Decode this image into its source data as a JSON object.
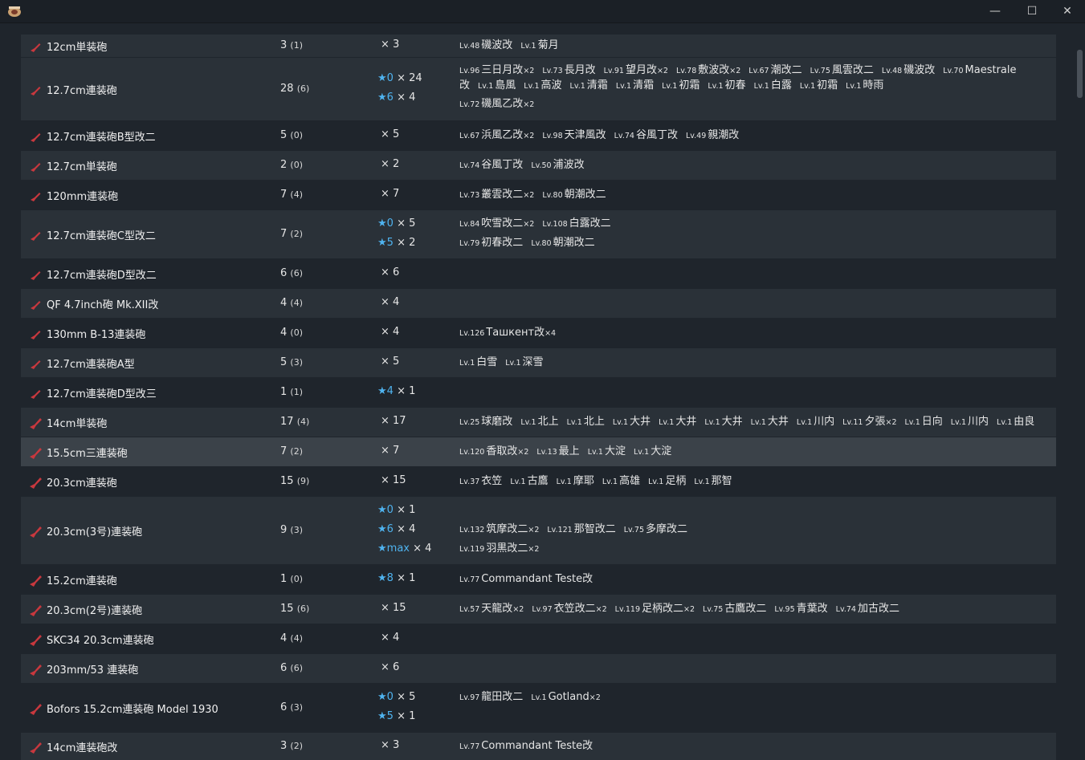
{
  "window": {
    "minimize": "—",
    "maximize": "☐",
    "close": "✕"
  },
  "colors": {
    "row_alt": "#2a3138",
    "row_selected": "#3b4249",
    "star": "#4fb3ef",
    "gun_icon": "#c8383e"
  },
  "rows": [
    {
      "name": "12cm単装砲",
      "count": "3",
      "count_locked": "(1)",
      "improvements": [
        {
          "star": "",
          "times": "× 3"
        }
      ],
      "ships": [
        [
          {
            "lv": "Lv.48",
            "name": "磯波改"
          },
          {
            "lv": "Lv.1",
            "name": "菊月"
          }
        ]
      ]
    },
    {
      "name": "12.7cm連装砲",
      "count": "28",
      "count_locked": "(6)",
      "improvements": [
        {
          "star": "★0",
          "times": "× 24"
        },
        {
          "star": "★6",
          "times": "× 4"
        }
      ],
      "ships": [
        [
          {
            "lv": "Lv.96",
            "name": "三日月改",
            "mult": "×2"
          },
          {
            "lv": "Lv.73",
            "name": "長月改"
          },
          {
            "lv": "Lv.91",
            "name": "望月改",
            "mult": "×2"
          },
          {
            "lv": "Lv.78",
            "name": "敷波改",
            "mult": "×2"
          },
          {
            "lv": "Lv.67",
            "name": "潮改二"
          },
          {
            "lv": "Lv.75",
            "name": "風雲改二"
          },
          {
            "lv": "Lv.48",
            "name": "磯波改"
          },
          {
            "lv": "Lv.70",
            "name": "Maestrale改"
          },
          {
            "lv": "Lv.1",
            "name": "島風"
          },
          {
            "lv": "Lv.1",
            "name": "高波"
          },
          {
            "lv": "Lv.1",
            "name": "清霜"
          },
          {
            "lv": "Lv.1",
            "name": "清霜"
          },
          {
            "lv": "Lv.1",
            "name": "初霜"
          },
          {
            "lv": "Lv.1",
            "name": "初春"
          },
          {
            "lv": "Lv.1",
            "name": "白露"
          },
          {
            "lv": "Lv.1",
            "name": "初霜"
          },
          {
            "lv": "Lv.1",
            "name": "時雨"
          }
        ],
        [
          {
            "lv": "Lv.72",
            "name": "磯風乙改",
            "mult": "×2"
          }
        ]
      ]
    },
    {
      "name": "12.7cm連装砲B型改二",
      "count": "5",
      "count_locked": "(0)",
      "improvements": [
        {
          "star": "",
          "times": "× 5"
        }
      ],
      "ships": [
        [
          {
            "lv": "Lv.67",
            "name": "浜風乙改",
            "mult": "×2"
          },
          {
            "lv": "Lv.98",
            "name": "天津風改"
          },
          {
            "lv": "Lv.74",
            "name": "谷風丁改"
          },
          {
            "lv": "Lv.49",
            "name": "親潮改"
          }
        ]
      ]
    },
    {
      "name": "12.7cm単装砲",
      "count": "2",
      "count_locked": "(0)",
      "improvements": [
        {
          "star": "",
          "times": "× 2"
        }
      ],
      "ships": [
        [
          {
            "lv": "Lv.74",
            "name": "谷風丁改"
          },
          {
            "lv": "Lv.50",
            "name": "浦波改"
          }
        ]
      ]
    },
    {
      "name": "120mm連装砲",
      "count": "7",
      "count_locked": "(4)",
      "improvements": [
        {
          "star": "",
          "times": "× 7"
        }
      ],
      "ships": [
        [
          {
            "lv": "Lv.73",
            "name": "叢雲改二",
            "mult": "×2"
          },
          {
            "lv": "Lv.80",
            "name": "朝潮改二"
          }
        ]
      ]
    },
    {
      "name": "12.7cm連装砲C型改二",
      "count": "7",
      "count_locked": "(2)",
      "improvements": [
        {
          "star": "★0",
          "times": "× 5"
        },
        {
          "star": "★5",
          "times": "× 2"
        }
      ],
      "ships": [
        [
          {
            "lv": "Lv.84",
            "name": "吹雪改二",
            "mult": "×2"
          },
          {
            "lv": "Lv.108",
            "name": "白露改二"
          }
        ],
        [
          {
            "lv": "Lv.79",
            "name": "初春改二"
          },
          {
            "lv": "Lv.80",
            "name": "朝潮改二"
          }
        ]
      ]
    },
    {
      "name": "12.7cm連装砲D型改二",
      "count": "6",
      "count_locked": "(6)",
      "improvements": [
        {
          "star": "",
          "times": "× 6"
        }
      ],
      "ships": []
    },
    {
      "name": "QF 4.7inch砲 Mk.XII改",
      "count": "4",
      "count_locked": "(4)",
      "improvements": [
        {
          "star": "",
          "times": "× 4"
        }
      ],
      "ships": []
    },
    {
      "name": "130mm B-13連装砲",
      "count": "4",
      "count_locked": "(0)",
      "improvements": [
        {
          "star": "",
          "times": "× 4"
        }
      ],
      "ships": [
        [
          {
            "lv": "Lv.126",
            "name": "Ташкент改",
            "mult": "×4"
          }
        ]
      ]
    },
    {
      "name": "12.7cm連装砲A型",
      "count": "5",
      "count_locked": "(3)",
      "improvements": [
        {
          "star": "",
          "times": "× 5"
        }
      ],
      "ships": [
        [
          {
            "lv": "Lv.1",
            "name": "白雪"
          },
          {
            "lv": "Lv.1",
            "name": "深雪"
          }
        ]
      ]
    },
    {
      "name": "12.7cm連装砲D型改三",
      "count": "1",
      "count_locked": "(1)",
      "improvements": [
        {
          "star": "★4",
          "times": "× 1"
        }
      ],
      "ships": []
    },
    {
      "name": "14cm単装砲",
      "count": "17",
      "count_locked": "(4)",
      "improvements": [
        {
          "star": "",
          "times": "× 17"
        }
      ],
      "ships": [
        [
          {
            "lv": "Lv.25",
            "name": "球磨改"
          },
          {
            "lv": "Lv.1",
            "name": "北上"
          },
          {
            "lv": "Lv.1",
            "name": "北上"
          },
          {
            "lv": "Lv.1",
            "name": "大井"
          },
          {
            "lv": "Lv.1",
            "name": "大井"
          },
          {
            "lv": "Lv.1",
            "name": "大井"
          },
          {
            "lv": "Lv.1",
            "name": "大井"
          },
          {
            "lv": "Lv.1",
            "name": "川内"
          },
          {
            "lv": "Lv.11",
            "name": "夕張",
            "mult": "×2"
          },
          {
            "lv": "Lv.1",
            "name": "日向"
          },
          {
            "lv": "Lv.1",
            "name": "川内"
          },
          {
            "lv": "Lv.1",
            "name": "由良"
          }
        ]
      ]
    },
    {
      "name": "15.5cm三連装砲",
      "count": "7",
      "count_locked": "(2)",
      "improvements": [
        {
          "star": "",
          "times": "× 7"
        }
      ],
      "ships": [
        [
          {
            "lv": "Lv.120",
            "name": "香取改",
            "mult": "×2"
          },
          {
            "lv": "Lv.13",
            "name": "最上"
          },
          {
            "lv": "Lv.1",
            "name": "大淀"
          },
          {
            "lv": "Lv.1",
            "name": "大淀"
          }
        ]
      ]
    },
    {
      "name": "20.3cm連装砲",
      "count": "15",
      "count_locked": "(9)",
      "improvements": [
        {
          "star": "",
          "times": "× 15"
        }
      ],
      "ships": [
        [
          {
            "lv": "Lv.37",
            "name": "衣笠"
          },
          {
            "lv": "Lv.1",
            "name": "古鷹"
          },
          {
            "lv": "Lv.1",
            "name": "摩耶"
          },
          {
            "lv": "Lv.1",
            "name": "高雄"
          },
          {
            "lv": "Lv.1",
            "name": "足柄"
          },
          {
            "lv": "Lv.1",
            "name": "那智"
          }
        ]
      ]
    },
    {
      "name": "20.3cm(3号)連装砲",
      "count": "9",
      "count_locked": "(3)",
      "improvements": [
        {
          "star": "★0",
          "times": "× 1"
        },
        {
          "star": "★6",
          "times": "× 4"
        },
        {
          "star": "★max",
          "times": "× 4"
        }
      ],
      "ships": [
        [],
        [
          {
            "lv": "Lv.132",
            "name": "筑摩改二",
            "mult": "×2"
          },
          {
            "lv": "Lv.121",
            "name": "那智改二"
          },
          {
            "lv": "Lv.75",
            "name": "多摩改二"
          }
        ],
        [
          {
            "lv": "Lv.119",
            "name": "羽黒改二",
            "mult": "×2"
          }
        ]
      ]
    },
    {
      "name": "15.2cm連装砲",
      "count": "1",
      "count_locked": "(0)",
      "improvements": [
        {
          "star": "★8",
          "times": "× 1"
        }
      ],
      "ships": [
        [
          {
            "lv": "Lv.77",
            "name": "Commandant Teste改"
          }
        ]
      ]
    },
    {
      "name": "20.3cm(2号)連装砲",
      "count": "15",
      "count_locked": "(6)",
      "improvements": [
        {
          "star": "",
          "times": "× 15"
        }
      ],
      "ships": [
        [
          {
            "lv": "Lv.57",
            "name": "天龍改",
            "mult": "×2"
          },
          {
            "lv": "Lv.97",
            "name": "衣笠改二",
            "mult": "×2"
          },
          {
            "lv": "Lv.119",
            "name": "足柄改二",
            "mult": "×2"
          },
          {
            "lv": "Lv.75",
            "name": "古鷹改二"
          },
          {
            "lv": "Lv.95",
            "name": "青葉改"
          },
          {
            "lv": "Lv.74",
            "name": "加古改二"
          }
        ]
      ]
    },
    {
      "name": "SKC34 20.3cm連装砲",
      "count": "4",
      "count_locked": "(4)",
      "improvements": [
        {
          "star": "",
          "times": "× 4"
        }
      ],
      "ships": []
    },
    {
      "name": "203mm/53 連装砲",
      "count": "6",
      "count_locked": "(6)",
      "improvements": [
        {
          "star": "",
          "times": "× 6"
        }
      ],
      "ships": []
    },
    {
      "name": "Bofors 15.2cm連装砲 Model 1930",
      "count": "6",
      "count_locked": "(3)",
      "improvements": [
        {
          "star": "★0",
          "times": "× 5"
        },
        {
          "star": "★5",
          "times": "× 1"
        }
      ],
      "ships": [
        [
          {
            "lv": "Lv.97",
            "name": "龍田改二"
          },
          {
            "lv": "Lv.1",
            "name": "Gotland",
            "mult": "×2"
          }
        ],
        []
      ]
    },
    {
      "name": "14cm連装砲改",
      "count": "3",
      "count_locked": "(2)",
      "improvements": [
        {
          "star": "",
          "times": "× 3"
        }
      ],
      "ships": [
        [
          {
            "lv": "Lv.77",
            "name": "Commandant Teste改"
          }
        ]
      ]
    }
  ]
}
